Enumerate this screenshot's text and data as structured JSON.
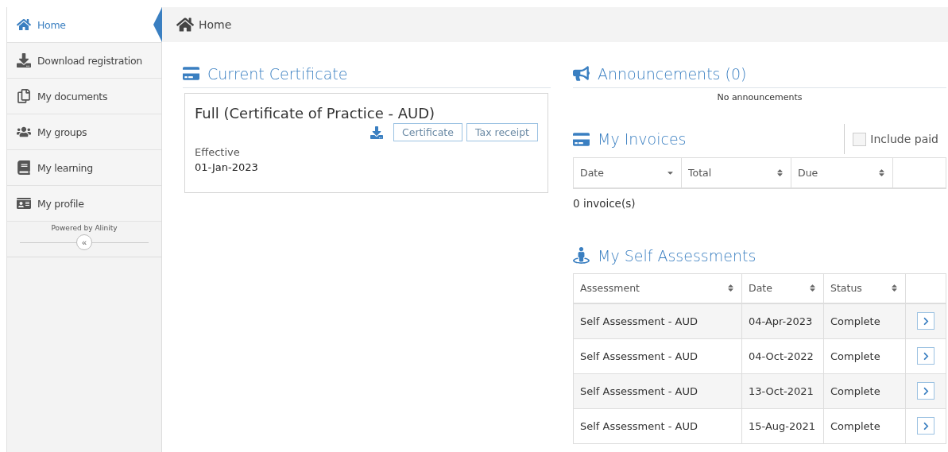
{
  "sidebar": {
    "items": [
      {
        "label": "Home",
        "selected": true
      },
      {
        "label": "Download registration",
        "selected": false
      },
      {
        "label": "My documents",
        "selected": false
      },
      {
        "label": "My groups",
        "selected": false
      },
      {
        "label": "My learning",
        "selected": false
      },
      {
        "label": "My profile",
        "selected": false
      }
    ],
    "powered_by": "Powered by Alinity",
    "collapse": "«"
  },
  "breadcrumb": "Home",
  "certificate": {
    "title": "Current Certificate",
    "name": "Full (Certificate of Practice - AUD)",
    "buttons": [
      "Certificate",
      "Tax receipt"
    ],
    "effective_label": "Effective",
    "effective_date": "01-Jan-2023"
  },
  "announcements": {
    "title": "Announcements (0)",
    "empty": "No announcements"
  },
  "invoices": {
    "title": "My Invoices",
    "include_paid": {
      "label": "Include paid",
      "checked": false
    },
    "columns": [
      {
        "label": "Date",
        "sorted": true
      },
      {
        "label": "Total",
        "sorted": false
      },
      {
        "label": "Due",
        "sorted": false
      }
    ],
    "count": "0 invoice(s)"
  },
  "self_assessments": {
    "title": "My Self Assessments",
    "columns": [
      {
        "label": "Assessment",
        "sorted": false
      },
      {
        "label": "Date",
        "sorted": false
      },
      {
        "label": "Status",
        "sorted": false
      }
    ],
    "rows": [
      {
        "assessment": "Self Assessment - AUD",
        "date": "04-Apr-2023",
        "status": "Complete"
      },
      {
        "assessment": "Self Assessment - AUD",
        "date": "04-Oct-2022",
        "status": "Complete"
      },
      {
        "assessment": "Self Assessment - AUD",
        "date": "13-Oct-2021",
        "status": "Complete"
      },
      {
        "assessment": "Self Assessment - AUD",
        "date": "15-Aug-2021",
        "status": "Complete"
      }
    ]
  }
}
